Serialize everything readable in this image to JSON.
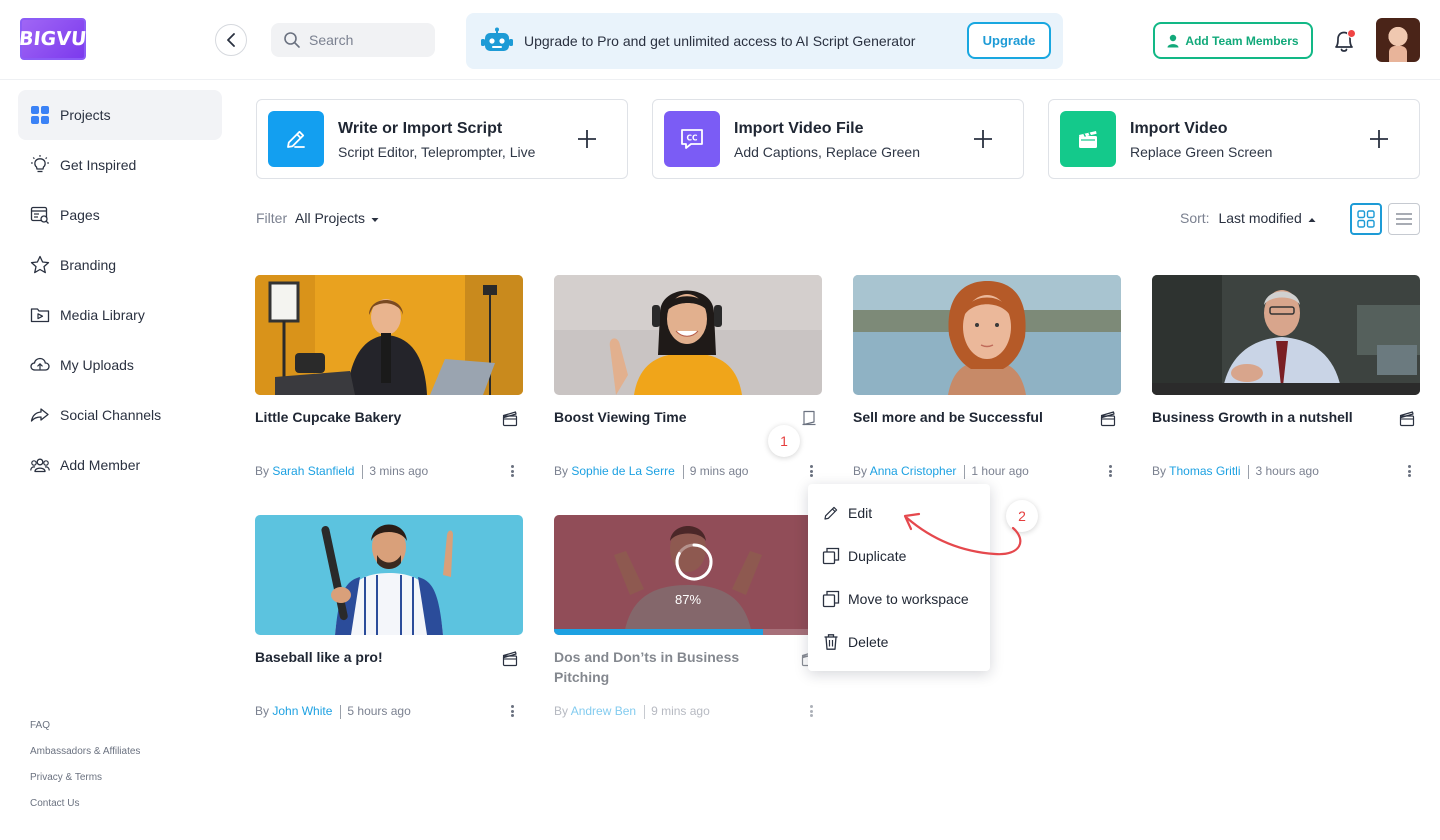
{
  "header": {
    "logo_text": "BIGVU",
    "search_placeholder": "Search",
    "promo_text": "Upgrade to Pro and get unlimited access to AI Script Generator",
    "upgrade_label": "Upgrade",
    "add_team_label": "Add Team Members"
  },
  "sidebar": {
    "items": [
      {
        "label": "Projects",
        "icon": "grid-icon",
        "active": true
      },
      {
        "label": "Get Inspired",
        "icon": "lightbulb-icon"
      },
      {
        "label": "Pages",
        "icon": "pages-icon"
      },
      {
        "label": "Branding",
        "icon": "star-icon"
      },
      {
        "label": "Media Library",
        "icon": "folder-play-icon"
      },
      {
        "label": "My Uploads",
        "icon": "cloud-upload-icon"
      },
      {
        "label": "Social Channels",
        "icon": "share-icon"
      },
      {
        "label": "Add Member",
        "icon": "users-icon"
      }
    ],
    "footer": [
      "FAQ",
      "Ambassadors  & Affiliates",
      "Privacy & Terms",
      "Contact Us"
    ]
  },
  "actions": [
    {
      "title": "Write or Import Script",
      "subtitle": "Script Editor, Teleprompter, Live",
      "color": "#139ff0",
      "icon": "pencil-icon"
    },
    {
      "title": "Import Video File",
      "subtitle": "Add Captions, Replace Green",
      "color": "#7b5cf5",
      "icon": "captions-icon"
    },
    {
      "title": "Import Video",
      "subtitle": "Replace Green Screen",
      "color": "#14c98b",
      "icon": "clapperboard-icon"
    }
  ],
  "toolbar": {
    "filter_label": "Filter",
    "filter_value": "All Projects",
    "sort_label": "Sort:",
    "sort_value": "Last modified"
  },
  "projects": [
    {
      "title": "Little Cupcake Bakery",
      "author": "Sarah Stanfield",
      "time": "3 mins ago",
      "by": "By"
    },
    {
      "title": "Boost Viewing Time",
      "author": "Sophie de La Serre",
      "time": "9 mins ago",
      "by": "By"
    },
    {
      "title": "Sell more and be Successful",
      "author": "Anna Cristopher",
      "time": "1 hour ago",
      "by": "By"
    },
    {
      "title": "Business Growth in a nutshell",
      "author": "Thomas Gritli",
      "time": "3 hours ago",
      "by": "By"
    },
    {
      "title": "Baseball like a pro!",
      "author": "John White",
      "time": "5 hours ago",
      "by": "By"
    },
    {
      "title": "Dos and Don’ts in Business Pitching",
      "author": "Andrew Ben",
      "time": "9 mins ago",
      "by": "By",
      "progress_text": "87%",
      "progress": 0.78
    }
  ],
  "context_menu": {
    "items": [
      {
        "label": "Edit",
        "icon": "pencil-icon"
      },
      {
        "label": "Duplicate",
        "icon": "duplicate-icon"
      },
      {
        "label": "Move to workspace",
        "icon": "move-icon"
      },
      {
        "label": "Delete",
        "icon": "trash-icon"
      }
    ]
  },
  "annotations": {
    "step1": "1",
    "step2": "2",
    "color": "#e53e3e"
  }
}
